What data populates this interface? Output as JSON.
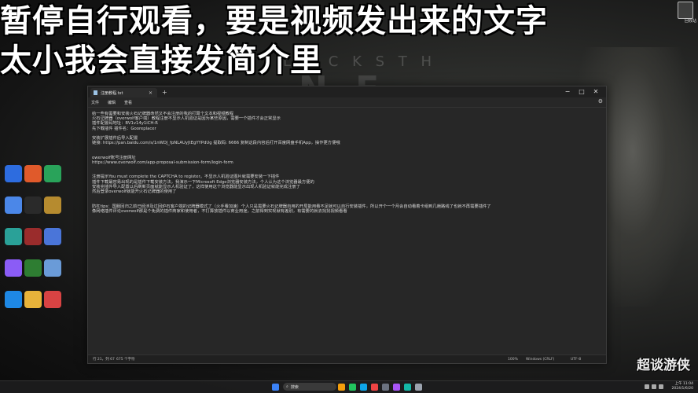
{
  "caption": {
    "line1": "暂停自行观看，要是视频发出来的文字",
    "line2": "太小我会直接发简介里"
  },
  "background": {
    "text1": "L A C K  S T H",
    "text2": "N E"
  },
  "desktop": {
    "recycle_bin_label": "回收站",
    "icons": [
      {
        "label": "",
        "color": "#2d6cdf"
      },
      {
        "label": "",
        "color": "#e05a2b"
      },
      {
        "label": "",
        "color": "#29a35a"
      },
      {
        "label": "",
        "color": "#4b87e8"
      },
      {
        "label": "",
        "color": "#2a2a2a"
      },
      {
        "label": "",
        "color": "#b68b2f"
      },
      {
        "label": "",
        "color": "#2aa198"
      },
      {
        "label": "",
        "color": "#9a2c2c"
      },
      {
        "label": "",
        "color": "#4a75d9"
      },
      {
        "label": "",
        "color": "#8b5cf6"
      },
      {
        "label": "",
        "color": "#2e7d32"
      },
      {
        "label": "",
        "color": "#6a9bd8"
      },
      {
        "label": "",
        "color": "#1e88e5"
      },
      {
        "label": "",
        "color": "#e8b33a"
      },
      {
        "label": "",
        "color": "#d84343"
      }
    ]
  },
  "notepad": {
    "tab_title": "注册教程.txt",
    "menu": [
      "文件",
      "编辑",
      "查看"
    ],
    "lines": [
      "给一些有需要和安装火石记牌器命然又不会注册的我的打算个文本和视频教程",
      "火石记牌器（overwolf客户端）教程注册不显示人机验证是因为某些原因，需要一个插件才会正常显示",
      "插件配置码地址：BV1v14y1iCH-R",
      "先下载插件 插件名：Gooreplacer",
      "",
      "安装扩展插件后导入配置",
      "链接: https://pan.baidu.com/s/1nWDJ_fpNLAUyJtEgYYPdUg 提取码: 6666 复制这段内容后打开百度网盘手机App，操作更方便哦",
      "",
      "",
      "owerwolf账号注册网址",
      "https://www.overwolf.com/app-proposal-submission-form/login-form",
      "",
      "",
      "注册提示You must complete the CAPTCHA to register。不显示人机验证图片就需要安装一下插件",
      "插件下载最容易出现的是插件下载安装方法，我演示一下Microsoft Edge浏览器安装方法，个人认为这个浏览器最方便的",
      "安装完插件导入配置以后刷新页面就能显示人机验证了，这样使用这个浏览器能显示出现人机验证就能完成注册了",
      "然后登录overwolf就能开火石记牌器的使用了",
      "",
      "",
      "防杠tips：国服回归之前已经涉及过回炉石客户端的记牌器模式了（火手看加速）个人只是需要火石记牌器自用的开局能用看不足就可以自行安装插件，所以开个一个月会自动看着卡组到几趟路线了也就不再需要插件了",
      "像网络插件评论overwolf那是个免费的插件商家和使用者，不打算放插件以商业用途，之前得到实现就有差别，有需要的就去找找视频看看"
    ],
    "status": {
      "position": "行 21，列 67",
      "chars": "675 个字符",
      "zoom": "100%",
      "eol": "Windows (CRLF)",
      "encoding": "UTF-8"
    }
  },
  "taskbar": {
    "search_placeholder": "搜索",
    "time": "上午 11:04",
    "date": "2024/1/6/20"
  },
  "watermark": "超谈游侠"
}
